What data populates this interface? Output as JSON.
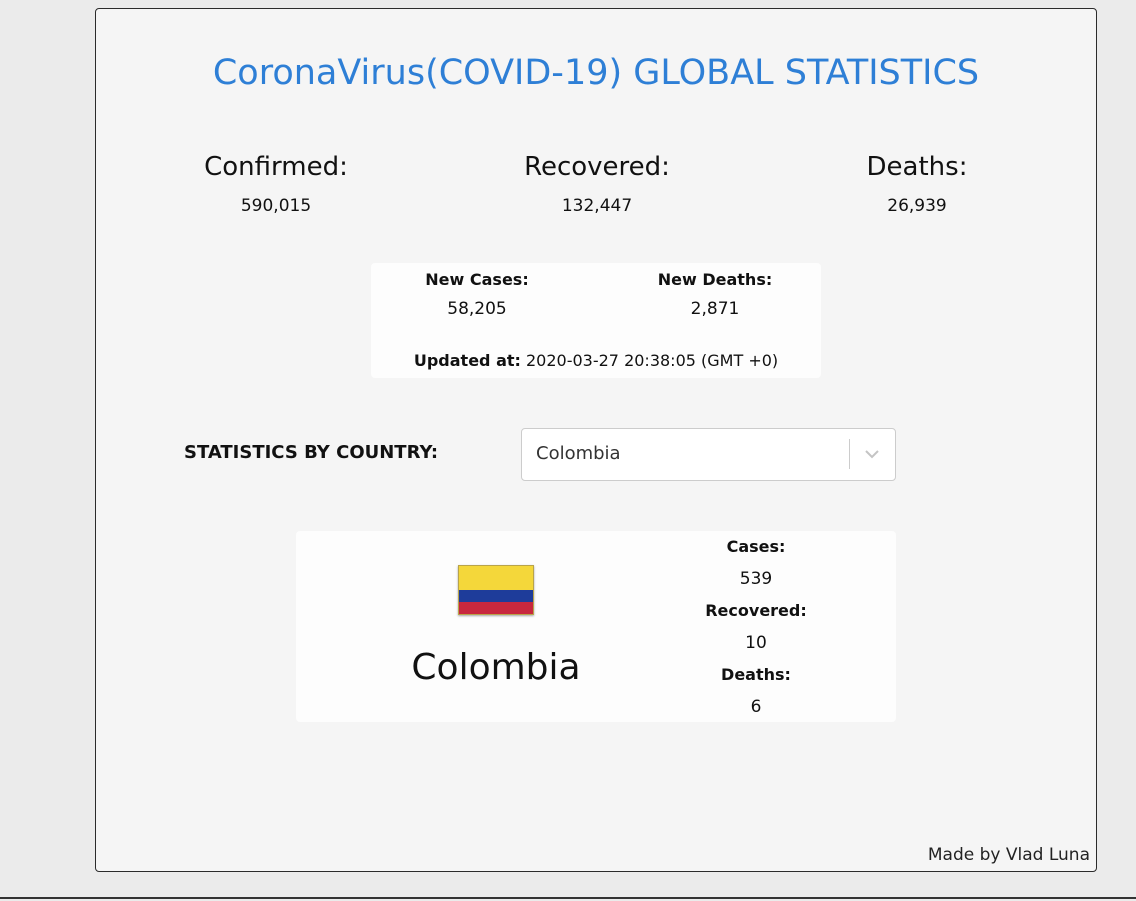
{
  "header": {
    "title": "CoronaVirus(COVID-19) GLOBAL STATISTICS"
  },
  "global_stats": {
    "confirmed": {
      "label": "Confirmed:",
      "value": "590,015"
    },
    "recovered": {
      "label": "Recovered:",
      "value": "132,447"
    },
    "deaths": {
      "label": "Deaths:",
      "value": "26,939"
    }
  },
  "daily": {
    "new_cases": {
      "label": "New Cases:",
      "value": "58,205"
    },
    "new_deaths": {
      "label": "New Deaths:",
      "value": "2,871"
    },
    "updated_label": "Updated at:",
    "updated_value": "2020-03-27 20:38:05 (GMT +0)"
  },
  "country_selector": {
    "label": "STATISTICS BY COUNTRY:",
    "selected": "Colombia",
    "icon": "chevron-down-icon"
  },
  "country_card": {
    "name": "Colombia",
    "flag_icon": "colombia-flag-icon",
    "flag_colors": [
      "#f4d73a",
      "#1e3c9a",
      "#c8283e"
    ],
    "cases": {
      "label": "Cases:",
      "value": "539"
    },
    "recovered": {
      "label": "Recovered:",
      "value": "10"
    },
    "deaths": {
      "label": "Deaths:",
      "value": "6"
    }
  },
  "footer": {
    "credit": "Made by Vlad Luna"
  },
  "colors": {
    "accent": "#2e7fd6",
    "panel_background": "#f5f5f5",
    "page_background": "#ebebeb"
  }
}
